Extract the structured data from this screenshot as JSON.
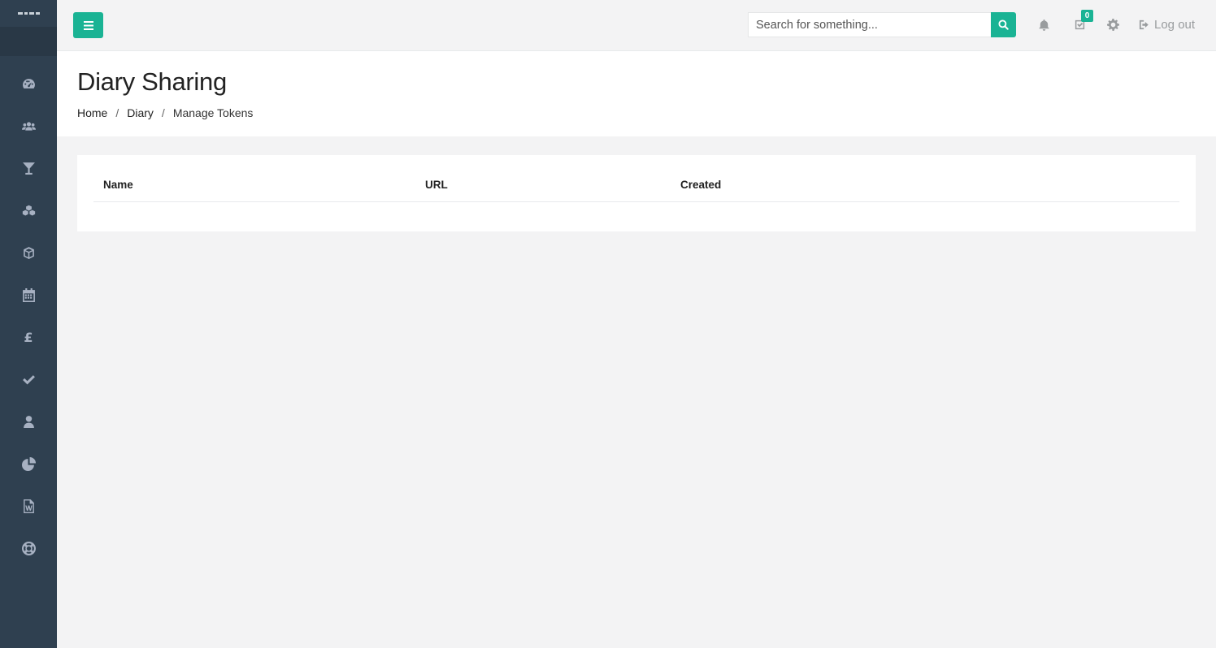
{
  "sidebar": {
    "items": [
      {
        "name": "dashboard",
        "icon": "tachometer-icon"
      },
      {
        "name": "clients",
        "icon": "users-icon"
      },
      {
        "name": "bar",
        "icon": "cocktail-glass-icon"
      },
      {
        "name": "products",
        "icon": "cubes-icon"
      },
      {
        "name": "inventory",
        "icon": "cube-icon"
      },
      {
        "name": "diary",
        "icon": "calendar-icon"
      },
      {
        "name": "finance",
        "icon": "pound-icon",
        "glyph": "£"
      },
      {
        "name": "tasks",
        "icon": "check-icon"
      },
      {
        "name": "staff",
        "icon": "user-icon"
      },
      {
        "name": "reports",
        "icon": "pie-chart-icon"
      },
      {
        "name": "documents",
        "icon": "word-file-icon"
      },
      {
        "name": "support",
        "icon": "life-ring-icon"
      }
    ]
  },
  "topbar": {
    "search_placeholder": "Search for something...",
    "tasks_badge": "0",
    "logout_label": "Log out"
  },
  "heading": {
    "title": "Diary Sharing",
    "breadcrumb": [
      "Home",
      "Diary",
      "Manage Tokens"
    ],
    "separator": "/"
  },
  "table": {
    "columns": [
      "Name",
      "URL",
      "Created"
    ],
    "rows": []
  },
  "colors": {
    "accent": "#1ab394",
    "sidebar": "#2f4050",
    "background": "#f3f3f4"
  }
}
